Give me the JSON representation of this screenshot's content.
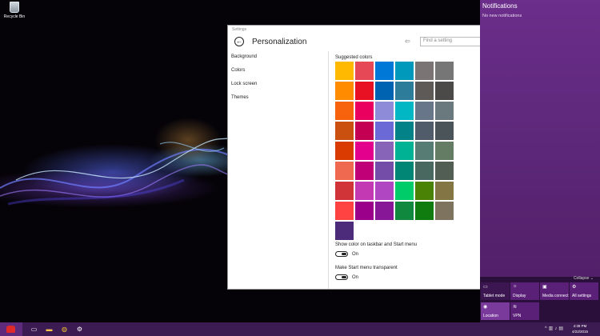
{
  "desktop": {
    "recycle_bin_label": "Recycle Bin"
  },
  "settings": {
    "window_title": "Settings",
    "page_title": "Personalization",
    "search_placeholder": "Find a setting",
    "nav": [
      "Background",
      "Colors",
      "Lock screen",
      "Themes"
    ],
    "suggested_colors_label": "Suggested colors",
    "swatch_grid": [
      [
        "#FFB900",
        "#E74856",
        "#0078D7",
        "#0099BC",
        "#7A7574",
        "#767676"
      ],
      [
        "#FF8C00",
        "#E81123",
        "#0063B1",
        "#2D7D9A",
        "#5D5A58",
        "#4C4A48"
      ],
      [
        "#F7630C",
        "#EA005E",
        "#8E8CD8",
        "#00B7C3",
        "#68768A",
        "#69797E"
      ],
      [
        "#CA5010",
        "#C30052",
        "#6B69D6",
        "#038387",
        "#515C6B",
        "#4A5459"
      ],
      [
        "#DA3B01",
        "#E3008C",
        "#8764B8",
        "#00B294",
        "#567C73",
        "#647C64"
      ],
      [
        "#EF6950",
        "#BF0077",
        "#744DA9",
        "#018574",
        "#486860",
        "#525E54"
      ],
      [
        "#D13438",
        "#C239B3",
        "#B146C2",
        "#00CC6A",
        "#498205",
        "#847545"
      ],
      [
        "#FF4343",
        "#9A0089",
        "#881798",
        "#10893E",
        "#107C10",
        "#7E735F"
      ]
    ],
    "selected_swatch_color": "#4C2B7B",
    "toggle1_label": "Show color on taskbar and Start menu",
    "toggle1_state": "On",
    "toggle2_label": "Make Start menu transparent",
    "toggle2_state": "On"
  },
  "action_center": {
    "title": "Notifications",
    "empty_text": "No new notifications",
    "collapse_label": "Collapse",
    "quick_actions": [
      {
        "label": "Tablet mode",
        "icon": "tablet-icon"
      },
      {
        "label": "Display",
        "icon": "display-icon"
      },
      {
        "label": "Media connect",
        "icon": "media-connect-icon"
      },
      {
        "label": "All settings",
        "icon": "settings-icon"
      },
      {
        "label": "Location",
        "icon": "location-icon"
      },
      {
        "label": "VPN",
        "icon": "vpn-icon"
      }
    ]
  },
  "taskbar": {
    "time": "4:39 PM",
    "date": "4/22/2015",
    "accent_color": "#3C1B52"
  }
}
